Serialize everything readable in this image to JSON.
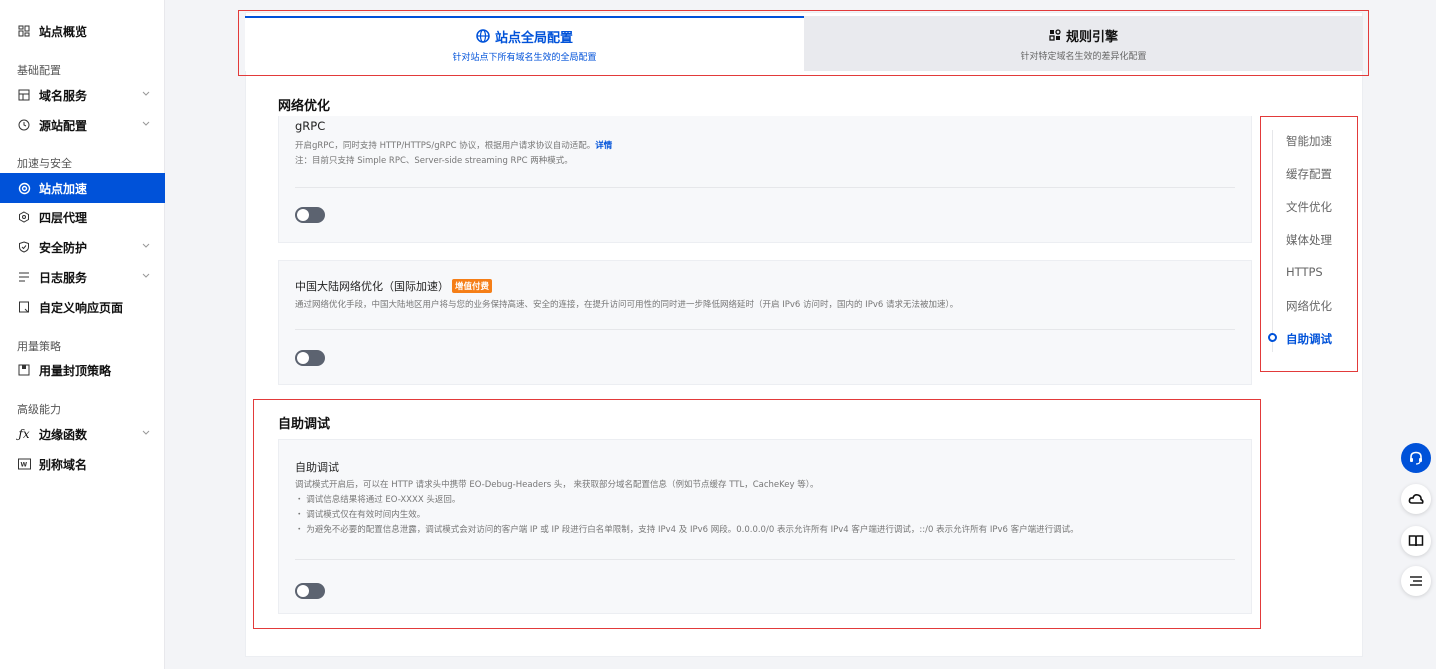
{
  "sidebar": {
    "top_item": {
      "label": "站点概览",
      "icon": "grid-icon"
    },
    "groups": [
      {
        "label": "基础配置",
        "items": [
          {
            "label": "域名服务",
            "icon": "domain-icon",
            "expandable": true
          },
          {
            "label": "源站配置",
            "icon": "origin-icon",
            "expandable": true
          }
        ]
      },
      {
        "label": "加速与安全",
        "items": [
          {
            "label": "站点加速",
            "icon": "gear-icon",
            "active": true
          },
          {
            "label": "四层代理",
            "icon": "hexagon-icon"
          },
          {
            "label": "安全防护",
            "icon": "shield-icon",
            "expandable": true
          },
          {
            "label": "日志服务",
            "icon": "list-icon",
            "expandable": true
          },
          {
            "label": "自定义响应页面",
            "icon": "page-icon"
          }
        ]
      },
      {
        "label": "用量策略",
        "items": [
          {
            "label": "用量封顶策略",
            "icon": "cap-icon"
          }
        ]
      },
      {
        "label": "高级能力",
        "items": [
          {
            "label": "边缘函数",
            "icon": "fx-icon",
            "expandable": true
          },
          {
            "label": "别称域名",
            "icon": "alias-icon"
          }
        ]
      }
    ]
  },
  "tabs": [
    {
      "title": "站点全局配置",
      "subtitle": "针对站点下所有域名生效的全局配置",
      "icon": "globe-icon",
      "active": true
    },
    {
      "title": "规则引擎",
      "subtitle": "针对特定域名生效的差异化配置",
      "icon": "rules-icon",
      "active": false
    }
  ],
  "network_section": {
    "title": "网络优化",
    "grpc": {
      "title": "gRPC",
      "desc1": "开启gRPC，同时支持 HTTP/HTTPS/gRPC 协议，根据用户请求协议自动适配。",
      "link": "详情",
      "desc2": "注：目前只支持 Simple RPC、Server-side streaming RPC 两种模式。",
      "enabled": false
    },
    "mainland": {
      "title": "中国大陆网络优化（国际加速）",
      "badge": "增值付费",
      "desc": "通过网络优化手段，中国大陆地区用户将与您的业务保持高速、安全的连接，在提升访问可用性的同时进一步降低网络延时（开启 IPv6 访问时，国内的 IPv6 请求无法被加速）。",
      "enabled": false
    }
  },
  "debug_section": {
    "title": "自助调试",
    "panel": {
      "title": "自助调试",
      "lines": [
        "调试模式开启后，可以在 HTTP 请求头中携带 EO-Debug-Headers 头， 来获取部分域名配置信息（例如节点缓存 TTL，CacheKey 等）。",
        "・ 调试信息结果将通过 EO-XXXX 头返回。",
        "・ 调试模式仅在有效时间内生效。",
        "・ 为避免不必要的配置信息泄露，调试模式会对访问的客户端 IP 或 IP 段进行白名单限制，支持 IPv4 及 IPv6 网段。0.0.0.0/0 表示允许所有 IPv4 客户端进行调试，::/0 表示允许所有 IPv6 客户端进行调试。"
      ],
      "enabled": false
    }
  },
  "anchors": [
    {
      "label": "智能加速"
    },
    {
      "label": "缓存配置"
    },
    {
      "label": "文件优化"
    },
    {
      "label": "媒体处理"
    },
    {
      "label": "HTTPS"
    },
    {
      "label": "网络优化"
    },
    {
      "label": "自助调试",
      "active": true
    }
  ],
  "fabs": [
    "headset-icon",
    "cloud-icon",
    "book-icon",
    "menu-icon"
  ],
  "colors": {
    "accent": "#0052d9",
    "highlight": "#e23a3a",
    "badge": "#f57e17"
  }
}
